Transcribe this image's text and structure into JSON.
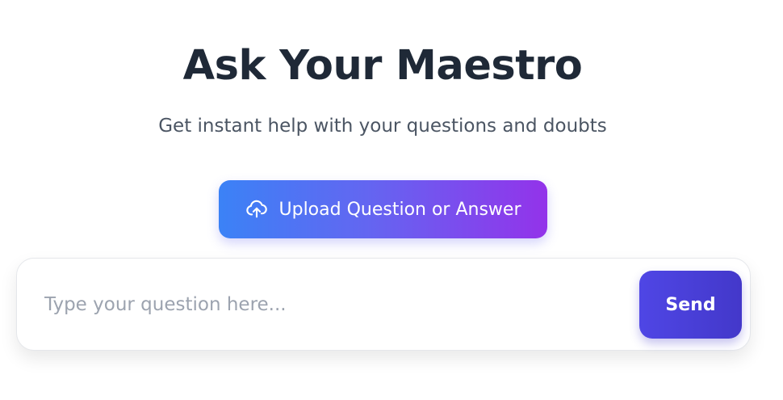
{
  "header": {
    "title": "Ask Your Maestro",
    "subtitle": "Get instant help with your questions and doubts"
  },
  "upload": {
    "label": "Upload Question or Answer",
    "icon": "cloud-upload-icon"
  },
  "chat": {
    "placeholder": "Type your question here...",
    "value": "",
    "send_label": "Send"
  },
  "colors": {
    "title": "#1f2937",
    "subtitle": "#4b5563",
    "upload_gradient_start": "#3b82f6",
    "upload_gradient_end": "#9333ea",
    "send_gradient_start": "#4f46e5",
    "send_gradient_end": "#4338ca",
    "placeholder": "#9ca3af"
  }
}
